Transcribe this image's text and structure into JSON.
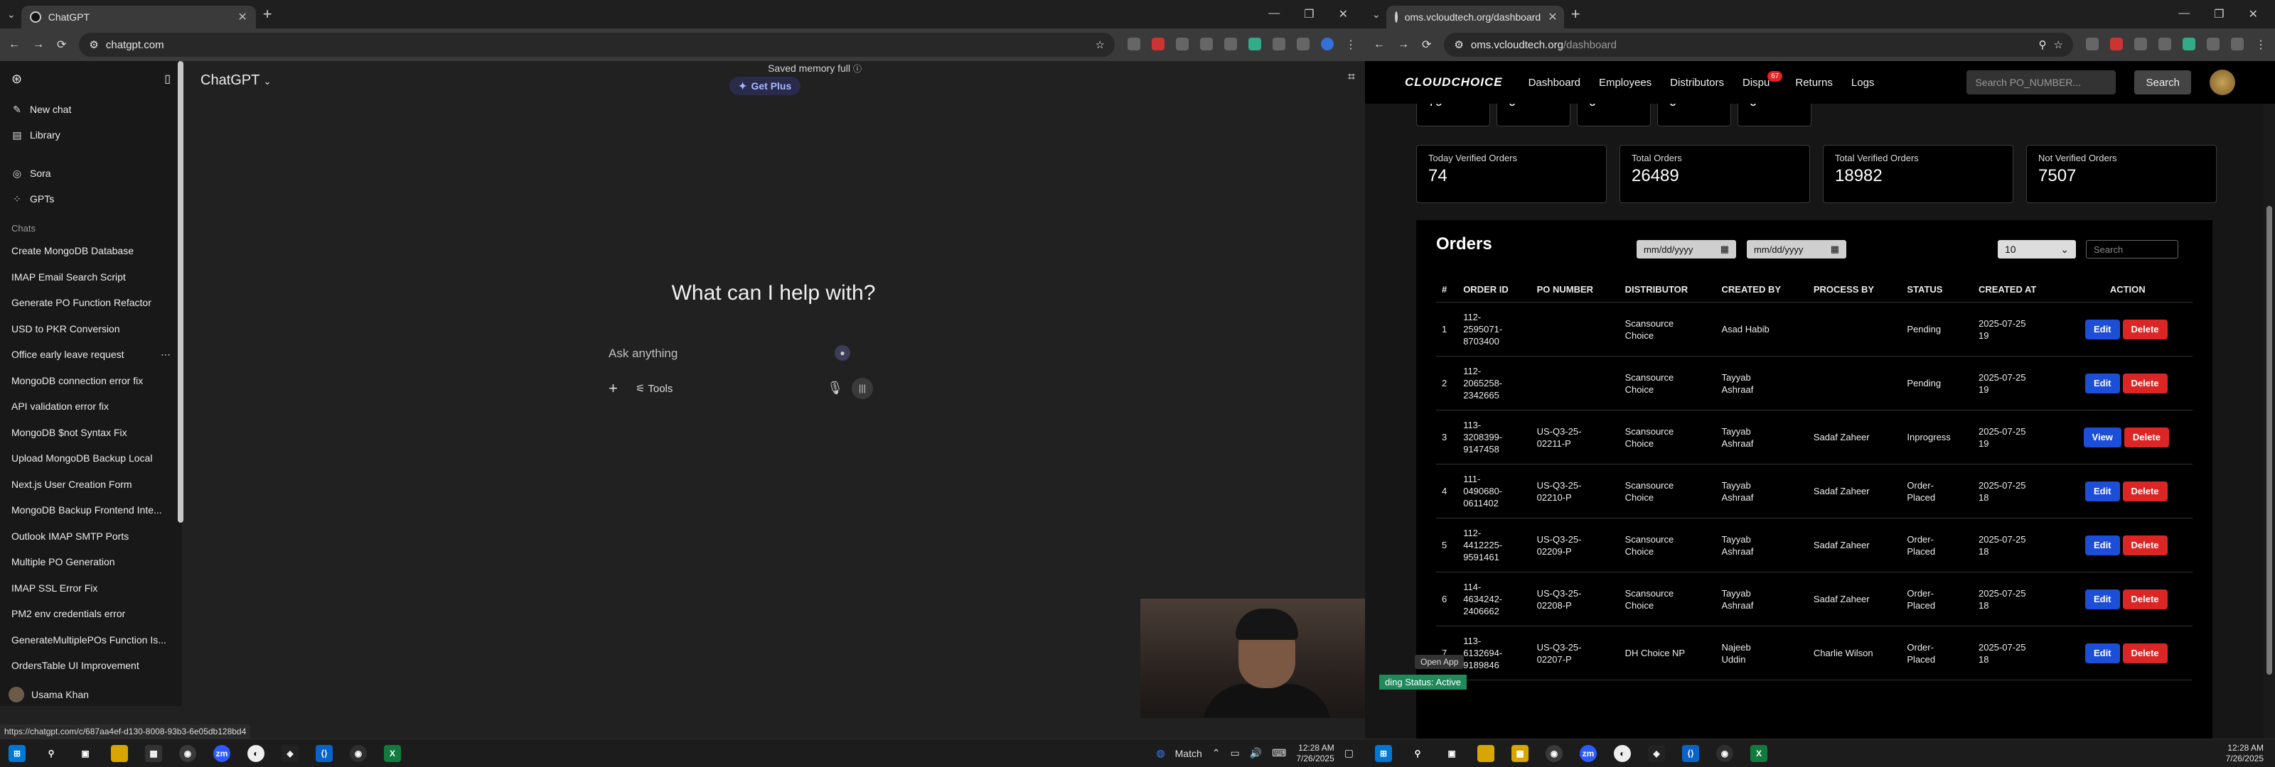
{
  "left": {
    "tab_title": "ChatGPT",
    "url": "chatgpt.com",
    "sidebar": {
      "items": [
        {
          "icon": "pencil-icon",
          "label": "New chat"
        },
        {
          "icon": "library-icon",
          "label": "Library"
        },
        {
          "icon": "sora-icon",
          "label": "Sora"
        },
        {
          "icon": "gpts-icon",
          "label": "GPTs"
        }
      ],
      "chats_heading": "Chats",
      "chats": [
        "Create MongoDB Database",
        "IMAP Email Search Script",
        "Generate PO Function Refactor",
        "USD to PKR Conversion",
        "Office early leave request",
        "MongoDB connection error fix",
        "API validation error fix",
        "MongoDB $not Syntax Fix",
        "Upload MongoDB Backup Local",
        "Next.js User Creation Form",
        "MongoDB Backup Frontend Inte...",
        "Outlook IMAP SMTP Ports",
        "Multiple PO Generation",
        "IMAP SSL Error Fix",
        "PM2 env credentials error",
        "GenerateMultiplePOs Function Is...",
        "OrdersTable UI Improvement"
      ],
      "user_name": "Usama Khan"
    },
    "header_title": "ChatGPT",
    "memory_notice": "Saved memory full",
    "get_plus": "Get Plus",
    "headline": "What can I help with?",
    "prompt_placeholder": "Ask anything",
    "tools_label": "Tools",
    "status_url": "https://chatgpt.com/c/687aa4ef-d130-8008-93b3-6e05db128bd4",
    "taskbar": {
      "match_label": "Match",
      "time": "12:28 AM",
      "date": "7/26/2025"
    }
  },
  "right": {
    "tab_title": "oms.vcloudtech.org/dashboard",
    "url_host": "oms.vcloudtech.org",
    "url_path": "/dashboard",
    "nav": {
      "logo": "CLOUDCHOICE",
      "links": [
        "Dashboard",
        "Employees",
        "Distributors",
        "Dispu",
        "Returns",
        "Logs"
      ],
      "disputes_badge": "67",
      "search_placeholder": "Search PO_NUMBER...",
      "search_button": "Search"
    },
    "top_stats": [
      "79",
      "0",
      "0",
      "0",
      "0"
    ],
    "stats": [
      {
        "label": "Today Verified Orders",
        "value": "74"
      },
      {
        "label": "Total Orders",
        "value": "26489"
      },
      {
        "label": "Total Verified Orders",
        "value": "18982"
      },
      {
        "label": "Not Verified Orders",
        "value": "7507"
      }
    ],
    "orders": {
      "title": "Orders",
      "date_placeholder": "mm/dd/yyyy",
      "page_size": "10",
      "search_placeholder": "Search",
      "columns": [
        "#",
        "ORDER ID",
        "PO NUMBER",
        "DISTRIBUTOR",
        "CREATED BY",
        "PROCESS BY",
        "STATUS",
        "CREATED AT",
        "ACTION"
      ],
      "rows": [
        {
          "n": "1",
          "order_id": "112-\n2595071-\n8703400",
          "po": "",
          "distributor": "Scansource\nChoice",
          "created_by": "Asad Habib",
          "process_by": "",
          "status": "Pending",
          "created_at": "2025-07-25\n19",
          "primary": "Edit",
          "secondary": "Delete"
        },
        {
          "n": "2",
          "order_id": "112-\n2065258-\n2342665",
          "po": "",
          "distributor": "Scansource\nChoice",
          "created_by": "Tayyab\nAshraaf",
          "process_by": "",
          "status": "Pending",
          "created_at": "2025-07-25\n19",
          "primary": "Edit",
          "secondary": "Delete"
        },
        {
          "n": "3",
          "order_id": "113-\n3208399-\n9147458",
          "po": "US-Q3-25-\n02211-P",
          "distributor": "Scansource\nChoice",
          "created_by": "Tayyab\nAshraaf",
          "process_by": "Sadaf Zaheer",
          "status": "Inprogress",
          "created_at": "2025-07-25\n19",
          "primary": "View",
          "secondary": "Delete"
        },
        {
          "n": "4",
          "order_id": "111-\n0490680-\n0611402",
          "po": "US-Q3-25-\n02210-P",
          "distributor": "Scansource\nChoice",
          "created_by": "Tayyab\nAshraaf",
          "process_by": "Sadaf Zaheer",
          "status": "Order-\nPlaced",
          "created_at": "2025-07-25\n18",
          "primary": "Edit",
          "secondary": "Delete"
        },
        {
          "n": "5",
          "order_id": "112-\n4412225-\n9591461",
          "po": "US-Q3-25-\n02209-P",
          "distributor": "Scansource\nChoice",
          "created_by": "Tayyab\nAshraaf",
          "process_by": "Sadaf Zaheer",
          "status": "Order-\nPlaced",
          "created_at": "2025-07-25\n18",
          "primary": "Edit",
          "secondary": "Delete"
        },
        {
          "n": "6",
          "order_id": "114-\n4634242-\n2406662",
          "po": "US-Q3-25-\n02208-P",
          "distributor": "Scansource\nChoice",
          "created_by": "Tayyab\nAshraaf",
          "process_by": "Sadaf Zaheer",
          "status": "Order-\nPlaced",
          "created_at": "2025-07-25\n18",
          "primary": "Edit",
          "secondary": "Delete"
        },
        {
          "n": "7",
          "order_id": "113-\n6132694-\n9189846",
          "po": "US-Q3-25-\n02207-P",
          "distributor": "DH Choice NP",
          "created_by": "Najeeb\nUddin",
          "process_by": "Charlie Wilson",
          "status": "Order-\nPlaced",
          "created_at": "2025-07-25\n18",
          "primary": "Edit",
          "secondary": "Delete"
        }
      ]
    },
    "open_app": "Open App",
    "status_pill": "ding Status: Active",
    "taskbar": {
      "time": "12:28 AM",
      "date": "7/26/2025"
    }
  }
}
